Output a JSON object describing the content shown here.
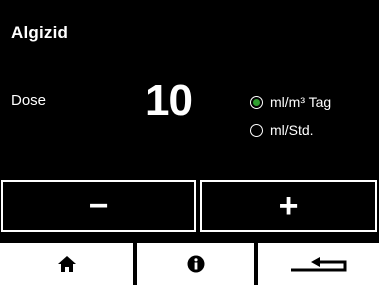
{
  "header": {
    "title": "Algizid"
  },
  "dose": {
    "label": "Dose",
    "value": "10"
  },
  "units": [
    {
      "label": "ml/m³ Tag",
      "selected": true
    },
    {
      "label": "ml/Std.",
      "selected": false
    }
  ],
  "controls": {
    "decrement_label": "−",
    "increment_label": "+"
  },
  "nav": {
    "home_icon": "home-icon",
    "info_icon": "info-icon",
    "back_icon": "return-icon"
  },
  "colors": {
    "background": "#000000",
    "foreground": "#ffffff",
    "radio_selected": "#2e9e2e"
  }
}
